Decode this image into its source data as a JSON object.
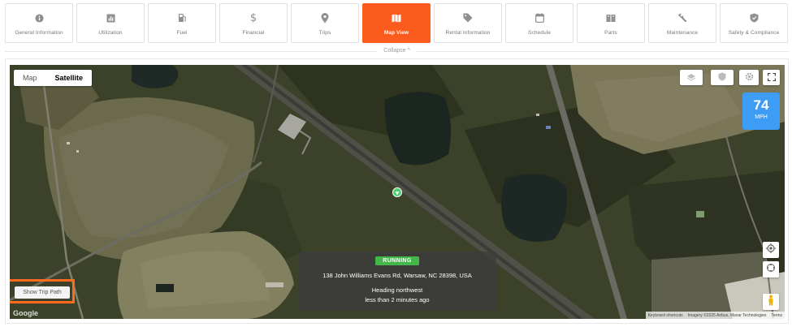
{
  "tabs": [
    {
      "label": "General Information",
      "icon": "info-icon",
      "active": false
    },
    {
      "label": "Utilization",
      "icon": "chart-icon",
      "active": false
    },
    {
      "label": "Fuel",
      "icon": "fuel-icon",
      "active": false
    },
    {
      "label": "Financial",
      "icon": "dollar-icon",
      "active": false
    },
    {
      "label": "Trips",
      "icon": "pin-icon",
      "active": false
    },
    {
      "label": "Map View",
      "icon": "map-icon",
      "active": true
    },
    {
      "label": "Rental Information",
      "icon": "tag-icon",
      "active": false
    },
    {
      "label": "Schedule",
      "icon": "calendar-icon",
      "active": false
    },
    {
      "label": "Parts",
      "icon": "parts-icon",
      "active": false
    },
    {
      "label": "Maintenance",
      "icon": "wrench-icon",
      "active": false
    },
    {
      "label": "Safety & Compliance",
      "icon": "shield-icon",
      "active": false
    }
  ],
  "collapse_label": "Collapse ^",
  "map": {
    "map_type": {
      "map": "Map",
      "satellite": "Satellite",
      "selected": "Satellite"
    },
    "speed": {
      "value": "74",
      "unit": "MPH"
    },
    "status": "RUNNING",
    "address": "138 John Williams Evans Rd, Warsaw, NC 28398, USA",
    "heading": "Heading northwest",
    "last_update": "less than 2 minutes ago",
    "show_trip_path": "Show Trip Path",
    "google_logo": "Google",
    "attribution": {
      "shortcuts": "Keyboard shortcuts",
      "imagery": "Imagery ©2025 Airbus, Maxar Technologies",
      "terms": "Terms"
    }
  },
  "colors": {
    "accent": "#fb5b1c",
    "speed": "#3d9cf5",
    "running": "#43b74a"
  }
}
